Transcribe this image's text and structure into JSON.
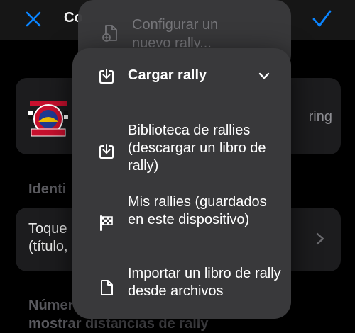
{
  "topbar": {
    "title": "Co"
  },
  "card_logo": {
    "right_text": "ring"
  },
  "sections": {
    "ident_header": "Identi",
    "ident_text": "Toque\n(título,",
    "num_header": "Númer\nmostrar distancias de rally"
  },
  "menu_back": {
    "label": "Configurar un\nnuevo rally..."
  },
  "menu": {
    "header_label": "Cargar rally",
    "items": [
      {
        "label": "Biblioteca de rallies (descargar un libro de rally)",
        "icon": "download-tray-icon"
      },
      {
        "label": "Mis rallies (guardados en este dispositivo)",
        "icon": "checkered-flag-icon"
      },
      {
        "label": "Importar un libro de rally desde archivos",
        "icon": "document-icon"
      }
    ]
  },
  "colors": {
    "accent": "#0a84ff",
    "menu_bg": "#39393b",
    "page_bg": "#000000"
  }
}
